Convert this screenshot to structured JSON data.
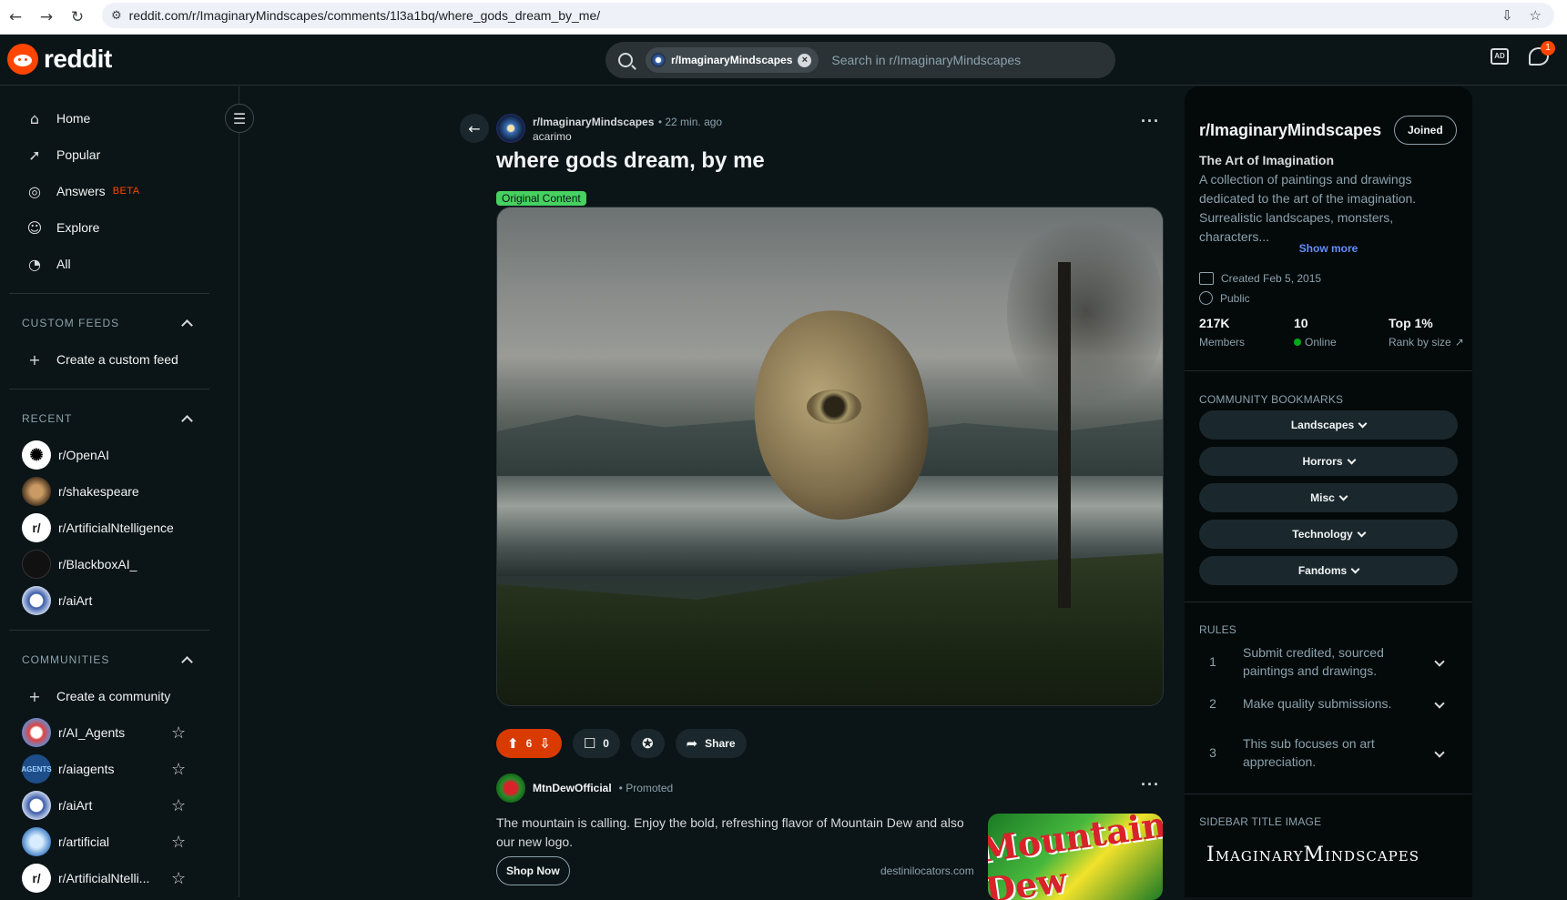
{
  "browser": {
    "url": "reddit.com/r/ImaginaryMindscapes/comments/1l3a1bq/where_gods_dream_by_me/",
    "icons": [
      "back-arrow-icon",
      "forward-arrow-icon",
      "reload-icon",
      "site-settings-icon",
      "install-icon",
      "bookmark-star-icon"
    ]
  },
  "header": {
    "logo_text": "reddit",
    "search_chip": "r/ImaginaryMindscapes",
    "search_placeholder": "Search in r/ImaginaryMindscapes",
    "chat_badge": "1",
    "ad_label": "AD"
  },
  "sidebar": {
    "nav": [
      {
        "label": "Home",
        "icon": "home-icon"
      },
      {
        "label": "Popular",
        "icon": "popular-icon"
      },
      {
        "label": "Answers",
        "icon": "answers-icon",
        "badge": "BETA"
      },
      {
        "label": "Explore",
        "icon": "explore-icon"
      },
      {
        "label": "All",
        "icon": "all-icon"
      }
    ],
    "custom_feeds_title": "CUSTOM FEEDS",
    "create_feed": "Create a custom feed",
    "recent_title": "RECENT",
    "recent": [
      "r/OpenAI",
      "r/shakespeare",
      "r/ArtificialNtelligence",
      "r/BlackboxAI_",
      "r/aiArt"
    ],
    "communities_title": "COMMUNITIES",
    "create_community": "Create a community",
    "communities": [
      "r/AI_Agents",
      "r/aiagents",
      "r/aiArt",
      "r/artificial",
      "r/ArtificialNtelli..."
    ]
  },
  "post": {
    "subreddit": "r/ImaginaryMindscapes",
    "time": "• 22 min. ago",
    "author": "acarimo",
    "title": "where gods dream, by me",
    "flair": "Original Content",
    "votes": "6",
    "comments": "0",
    "share": "Share"
  },
  "promo": {
    "name": "MtnDewOfficial",
    "tag": "• Promoted",
    "text": "The mountain is calling. Enjoy the bold, refreshing flavor of Mountain Dew and also our new logo.",
    "button": "Shop Now",
    "domain": "destinilocators.com",
    "image_text": "Mountain Dew"
  },
  "community": {
    "name": "r/ImaginaryMindscapes",
    "joined": "Joined",
    "subtitle": "The Art of Imagination",
    "description": "A collection of paintings and drawings dedicated to the art of the imagination. Surrealistic landscapes, monsters, characters...",
    "show_more": "Show more",
    "created": "Created Feb 5, 2015",
    "visibility": "Public",
    "members": "217K",
    "members_label": "Members",
    "online": "10",
    "online_label": "Online",
    "rank": "Top 1%",
    "rank_label": "Rank by size",
    "bookmarks_title": "COMMUNITY BOOKMARKS",
    "bookmarks": [
      "Landscapes",
      "Horrors",
      "Misc",
      "Technology",
      "Fandoms"
    ],
    "rules_title": "RULES",
    "rules": [
      {
        "n": "1",
        "text": "Submit credited, sourced paintings and drawings."
      },
      {
        "n": "2",
        "text": "Make quality submissions."
      },
      {
        "n": "3",
        "text": "This sub focuses on art appreciation."
      }
    ],
    "sidebar_image_title": "SIDEBAR TITLE IMAGE",
    "sidebar_image_text": "ImaginaryMindscapes"
  },
  "colors": {
    "accent": "#ff4500",
    "link": "#648efc",
    "flair": "#46d160",
    "bg": "#0b1416"
  }
}
